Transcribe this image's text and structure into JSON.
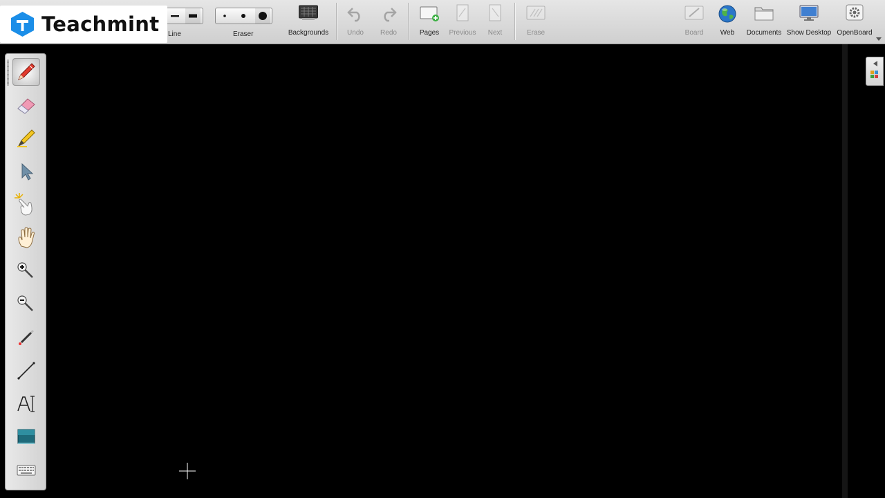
{
  "app": {
    "name": "OpenBoard"
  },
  "watermark": {
    "brand": "Teachmint",
    "color": "#1b8ee8"
  },
  "toolbar": {
    "line_label": "Line",
    "eraser_label": "Eraser",
    "backgrounds_label": "Backgrounds",
    "undo_label": "Undo",
    "redo_label": "Redo",
    "pages_label": "Pages",
    "previous_label": "Previous",
    "next_label": "Next",
    "erase_label": "Erase",
    "board_label": "Board",
    "web_label": "Web",
    "documents_label": "Documents",
    "show_desktop_label": "Show Desktop",
    "openboard_label": "OpenBoard"
  },
  "palette": {
    "tools": [
      {
        "name": "pen-icon",
        "active": true
      },
      {
        "name": "eraser-icon",
        "active": false
      },
      {
        "name": "highlighter-icon",
        "active": false
      },
      {
        "name": "selector-icon",
        "active": false
      },
      {
        "name": "interact-hand-icon",
        "active": false
      },
      {
        "name": "pan-hand-icon",
        "active": false
      },
      {
        "name": "zoom-in-icon",
        "active": false
      },
      {
        "name": "zoom-out-icon",
        "active": false
      },
      {
        "name": "laser-pointer-icon",
        "active": false
      },
      {
        "name": "line-tool-icon",
        "active": false
      },
      {
        "name": "text-tool-icon",
        "active": false
      },
      {
        "name": "capture-icon",
        "active": false
      },
      {
        "name": "keyboard-icon",
        "active": false
      }
    ]
  },
  "colors": {
    "board": "#000000",
    "toolbar": "#d9d9d9",
    "accent_green": "#3cb043"
  }
}
